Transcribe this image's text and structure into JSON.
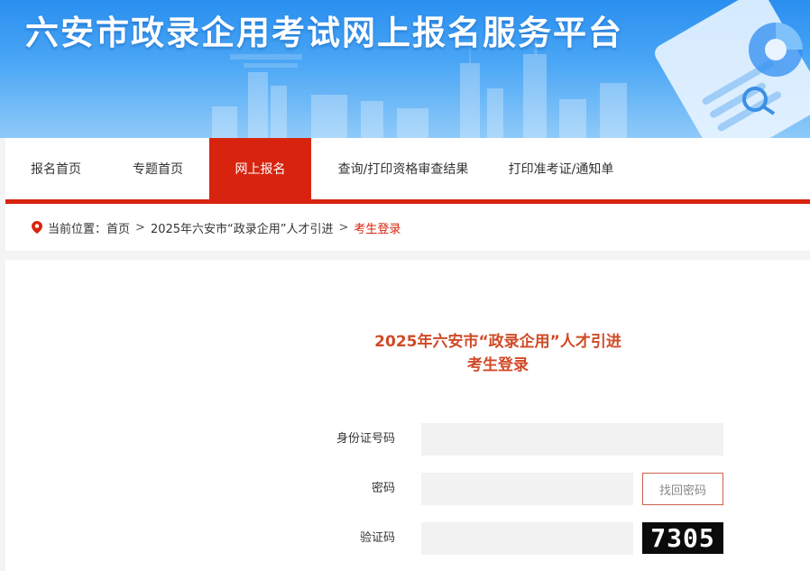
{
  "header": {
    "title": "六安市政录企用考试网上报名服务平台"
  },
  "nav": {
    "items": [
      {
        "label": "报名首页"
      },
      {
        "label": "专题首页"
      },
      {
        "label": "网上报名"
      },
      {
        "label": "查询/打印资格审查结果"
      },
      {
        "label": "打印准考证/通知单"
      }
    ],
    "active_index": 2
  },
  "breadcrumb": {
    "prefix": "当前位置：",
    "items": [
      "首页",
      "2025年六安市“政录企用”人才引进",
      "考生登录"
    ],
    "separator": ">"
  },
  "login": {
    "title_line1": "2025年六安市“政录企用”人才引进",
    "title_line2": "考生登录",
    "id_label": "身份证号码",
    "id_value": "",
    "password_label": "密码",
    "password_value": "",
    "find_password_label": "找回密码",
    "captcha_label": "验证码",
    "captcha_value": "",
    "captcha_image_text": "7305"
  },
  "colors": {
    "accent": "#d8240e",
    "title_red": "#d04a26",
    "banner_blue": "#2a8ff0"
  }
}
